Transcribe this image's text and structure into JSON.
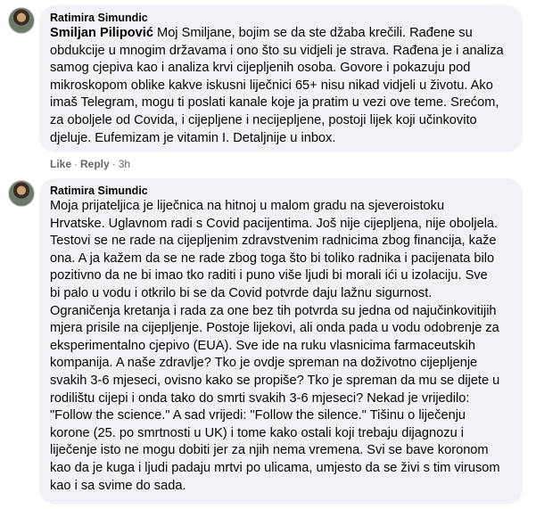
{
  "comments": [
    {
      "author": "Ratimira Simundic",
      "mention": "Smiljan Pilipović",
      "lines": [
        " Moj Smiljane, bojim se da ste džaba krečili. Rađene su",
        "obdukcije u mnogim državama i ono što su vidjeli je strava. Rađena je i analiza",
        "samog cjepiva kao i analiza krvi cijepljenih osoba. Govore i pokazuju pod",
        "mikroskopom oblike kakve iskusni liječnici 65+ nisu nikad vidjeli u životu. Ako",
        "imaš Telegram, mogu ti poslati kanale koje ja pratim u vezi ove teme. Srećom,",
        "za oboljele od Covida, i cijepljene i necijepljene, postoji lijek koji učinkovito",
        "djeluje. Eufemizam je vitamin I. Detaljnije u inbox."
      ],
      "like_label": "Like",
      "reply_label": "Reply",
      "separator": "·",
      "time": "3h"
    },
    {
      "author": "Ratimira Simundic",
      "lines": [
        "Moja prijateljica je liječnica na hitnoj u malom gradu na sjeveroistoku",
        "Hrvatske. Uglavnom radi s Covid pacijentima. Još nije cijepljena, nije oboljela.",
        "Testovi se ne rade na cijepljenim zdravstvenim radnicima zbog financija, kaže",
        "ona. A ja kažem da se ne rade zbog toga što bi toliko radnika i pacijenata bilo",
        "pozitivno da ne bi imao tko raditi i puno više ljudi bi morali ići u izolaciju. Sve",
        "bi palo u vodu i otkrilo bi se da Covid potvrde daju lažnu sigurnost.",
        "Ograničenja kretanja i rada za one bez tih potvrda su jedna od najučinkovitijih",
        "mjera prisile na cijepljenje. Postoje lijekovi, ali onda pada u vodu odobrenje za",
        "eksperimentalno cjepivo (EUA). Sve ide na ruku vlasnicima farmaceutskih",
        "kompanija. A naše zdravlje? Tko je ovdje spreman na doživotno cijepljenje",
        "svakih 3-6 mjeseci, ovisno kako se propiše? Tko je spreman da mu se dijete u",
        "rodilištu cijepi i onda tako do smrti svakih 3-6 mjeseci? Nekad je vrijedilo:",
        "\"Follow the science.\" A sad vrijedi: \"Follow the silence.\" Tišinu o liječenju",
        "korone (25. po smrtnosti u UK) i tome kako ostali koji trebaju dijagnozu i",
        "liječenje isto ne mogu dobiti jer za njih nema vremena. Svi se bave koronom",
        "kao da je kuga i ljudi padaju mrtvi po ulicama, umjesto da se živi s tim virusom",
        "kao i sa svime do sada."
      ]
    }
  ]
}
